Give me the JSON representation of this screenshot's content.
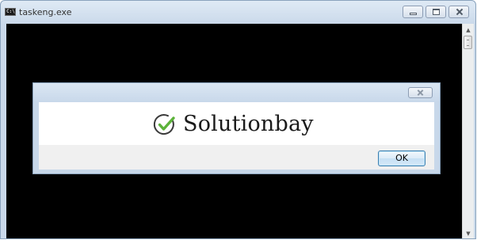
{
  "window": {
    "title": "taskeng.exe",
    "icon": "console-icon",
    "icon_text": "C:\\",
    "controls": [
      "minimize-icon",
      "maximize-icon",
      "close-icon"
    ]
  },
  "dialog": {
    "message": "Solutionbay",
    "message_icon": "check-icon",
    "ok_label": "OK",
    "close_icon": "close-icon"
  },
  "scrollbar": {
    "up_arrow": "▲",
    "down_arrow": "▼"
  },
  "colors": {
    "console_background": "#000000",
    "checkmark": "#5cb33a",
    "dialog_frame": "#c8d8ea"
  }
}
